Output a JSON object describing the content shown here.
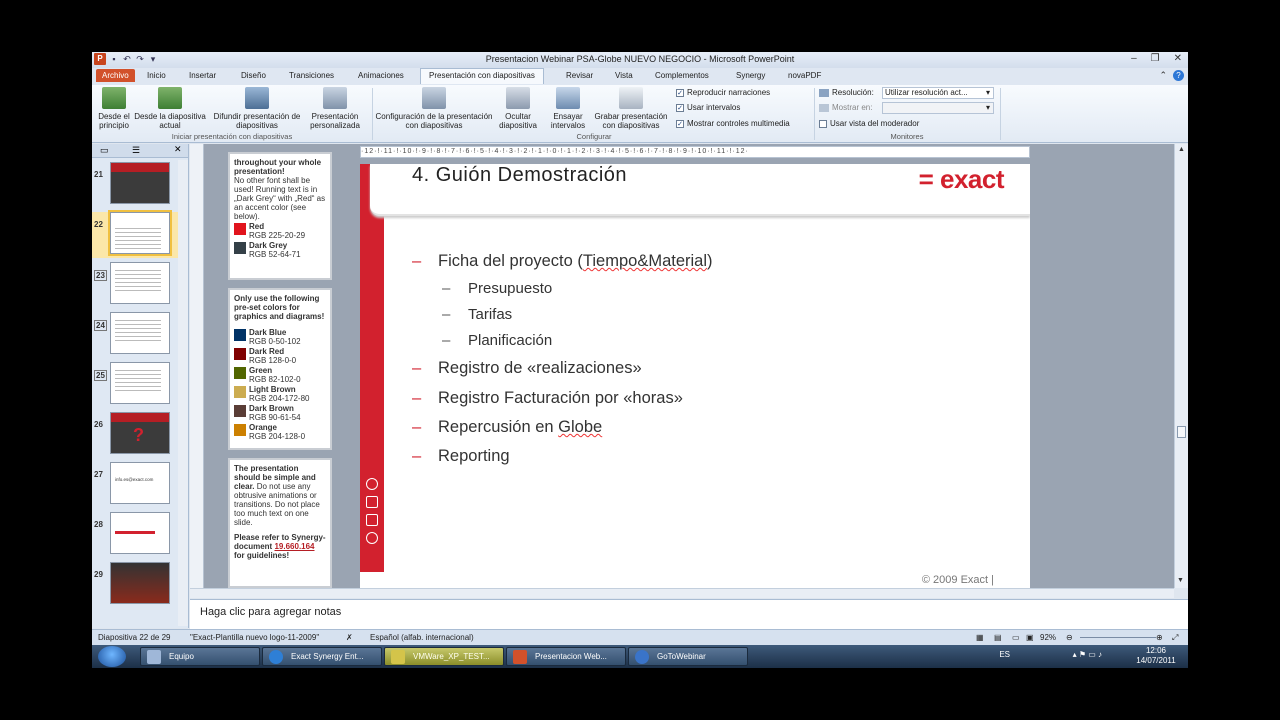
{
  "window": {
    "title": "Presentacion Webinar PSA-Globe NUEVO NEGOCIO  -  Microsoft PowerPoint"
  },
  "tabs": [
    "Archivo",
    "Inicio",
    "Insertar",
    "Diseño",
    "Transiciones",
    "Animaciones",
    "Presentación con diapositivas",
    "Revisar",
    "Vista",
    "Complementos",
    "Synergy",
    "novaPDF"
  ],
  "ribbon": {
    "btn_desde_principio": "Desde el principio",
    "btn_desde_actual": "Desde la diapositiva actual",
    "btn_difundir": "Difundir presentación de diapositivas",
    "btn_personalizada": "Presentación personalizada",
    "group_iniciar": "Iniciar presentación con diapositivas",
    "btn_configuracion": "Configuración de la presentación con diapositivas",
    "btn_ocultar": "Ocultar diapositiva",
    "btn_ensayar": "Ensayar intervalos",
    "btn_grabar": "Grabar presentación con diapositivas",
    "group_configurar": "Configurar",
    "chk_narraciones": "Reproducir narraciones",
    "chk_intervalos": "Usar intervalos",
    "chk_controles": "Mostrar controles multimedia",
    "resolucion_label": "Resolución:",
    "resolucion_value": "Utilizar resolución act...",
    "mostrar_en_label": "Mostrar en:",
    "chk_moderador": "Usar vista del moderador",
    "group_monitores": "Monitores"
  },
  "thumbnails": [
    {
      "num": "21"
    },
    {
      "num": "22"
    },
    {
      "num": "23"
    },
    {
      "num": "24"
    },
    {
      "num": "25"
    },
    {
      "num": "26"
    },
    {
      "num": "27",
      "text": "info.es@exact.com"
    },
    {
      "num": "28"
    },
    {
      "num": "29"
    }
  ],
  "instructions": {
    "p1_bold": "throughout your whole presentation!",
    "p1_text": "No other font shall be used! Running text is in „Dark Grey“ with „Red“ as an accent color (see below).",
    "p2_bold": "Only use the following pre-set colors for graphics and diagrams!",
    "p3_bold": "The presentation should be simple and clear.",
    "p3_text": "Do not use any obtrusive animations or transitions. Do not place too much text on one slide.",
    "p4_bold": "Please refer to Synergy-document",
    "p4_link": "19.660.164",
    "p4_end": "for guidelines!",
    "colors_top": [
      {
        "name": "Red",
        "rgb": "RGB 225-20-29",
        "hex": "#e1141d"
      },
      {
        "name": "Dark Grey",
        "rgb": "RGB 52-64-71",
        "hex": "#344047"
      }
    ],
    "colors": [
      {
        "name": "Dark Blue",
        "rgb": "RGB 0-50-102",
        "hex": "#003266"
      },
      {
        "name": "Dark Red",
        "rgb": "RGB 128-0-0",
        "hex": "#800000"
      },
      {
        "name": "Green",
        "rgb": "RGB 82-102-0",
        "hex": "#526600"
      },
      {
        "name": "Light Brown",
        "rgb": "RGB 204-172-80",
        "hex": "#ccac50"
      },
      {
        "name": "Dark Brown",
        "rgb": "RGB 90-61-54",
        "hex": "#5a3d36"
      },
      {
        "name": "Orange",
        "rgb": "RGB 204-128-0",
        "hex": "#cc8000"
      }
    ]
  },
  "ruler": "·12·!·11·!·10·!·9·!·8·!·7·!·6·!·5·!·4·!·3·!·2·!·1·!·0·!·1·!·2·!·3·!·4·!·5·!·6·!·7·!·8·!·9·!·10·!·11·!·12·",
  "slide": {
    "title": "4.  Guión Demostración",
    "logo": "= exact",
    "bullet1_pre": "Ficha del proyecto (",
    "bullet1_spell": "Tiempo&Material",
    "bullet1_post": ")",
    "sub1": "Presupuesto",
    "sub2": "Tarifas",
    "sub3": "Planificación",
    "bullet2": "Registro de «realizaciones»",
    "bullet3": "Registro Facturación por «horas»",
    "bullet4_pre": "Repercusión en ",
    "bullet4_spell": "Globe",
    "bullet5": "Reporting",
    "copyright": "© 2009 Exact |"
  },
  "notes": {
    "placeholder": "Haga clic para agregar notas"
  },
  "statusbar": {
    "slide_count": "Diapositiva 22 de 29",
    "theme": "\"Exact-Plantilla nuevo logo-11-2009\"",
    "language": "Español (alfab. internacional)",
    "zoom": "92%"
  },
  "taskbar": {
    "items": [
      "Equipo",
      "Exact Synergy Ent...",
      "VMWare_XP_TEST...",
      "Presentacion Web...",
      "GoToWebinar"
    ],
    "lang": "ES",
    "time": "12:06",
    "date": "14/07/2011"
  },
  "colors": {
    "accent_red": "#d2212e",
    "ribbon_blue": "#dfe7f2"
  }
}
